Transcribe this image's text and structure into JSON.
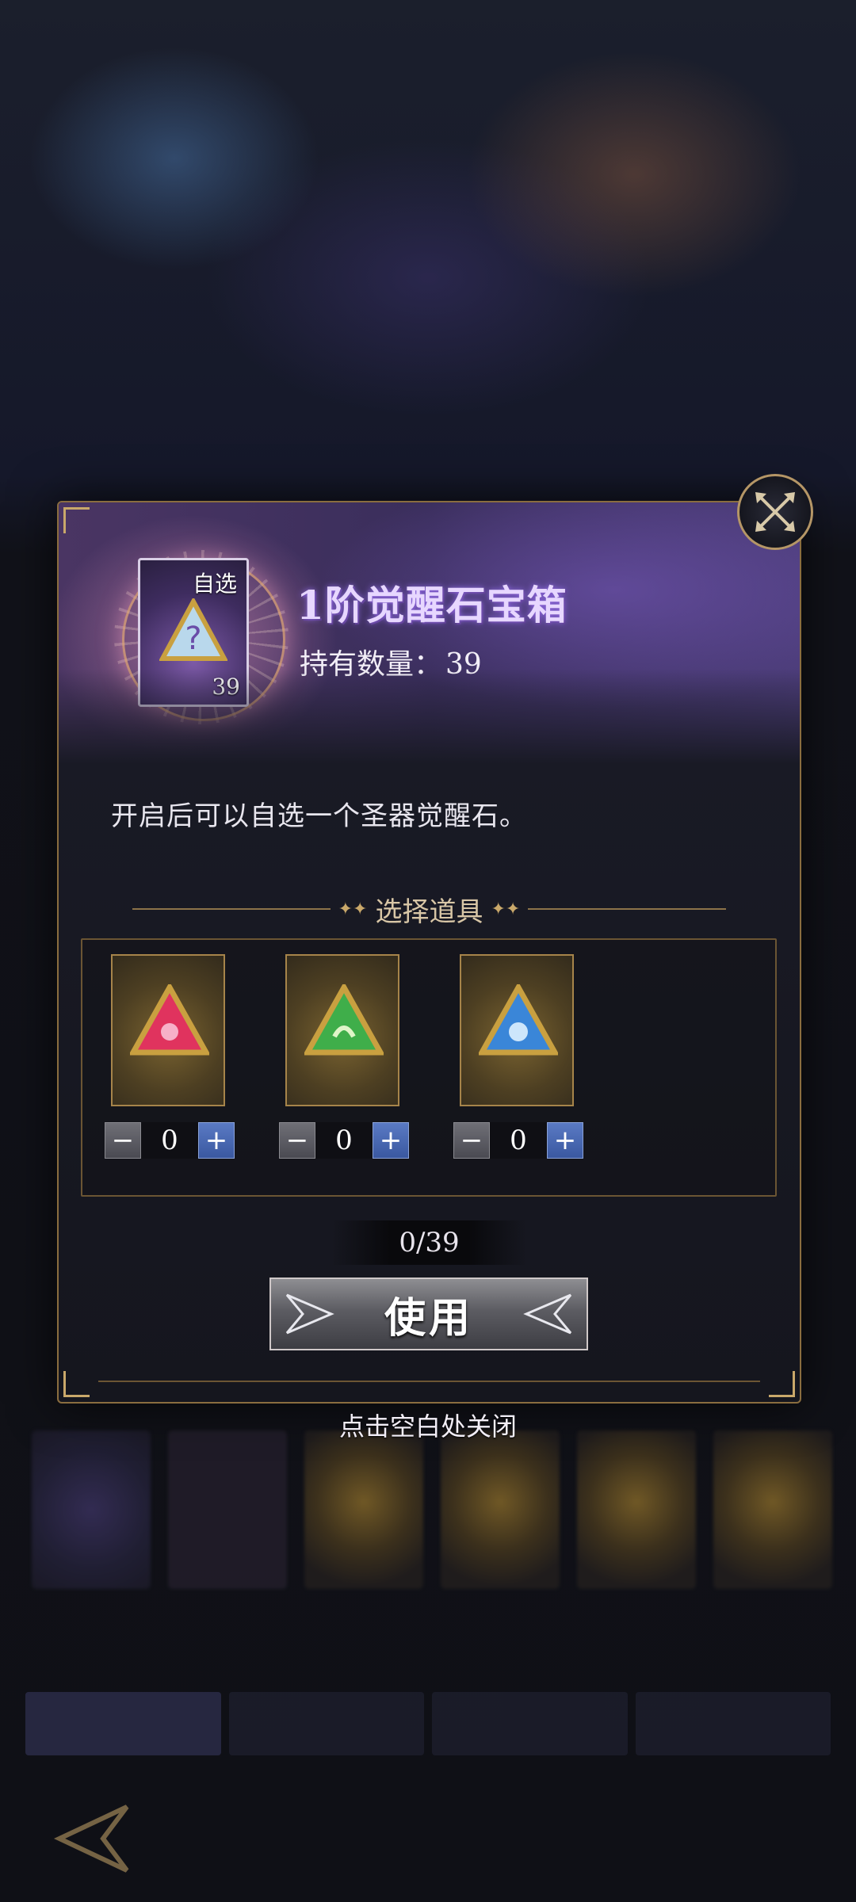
{
  "item": {
    "name": "1阶觉醒石宝箱",
    "owned_label": "持有数量：",
    "owned_count": "39",
    "card_tag": "自选",
    "card_qty": "39",
    "description": "开启后可以自选一个圣器觉醒石。"
  },
  "selection": {
    "title": "选择道具",
    "options": [
      {
        "name": "red-awakening-stone",
        "gem_color": "#e0335e",
        "value": "0",
        "minus": "−",
        "plus": "+"
      },
      {
        "name": "green-awakening-stone",
        "gem_color": "#3fae4a",
        "value": "0",
        "minus": "−",
        "plus": "+"
      },
      {
        "name": "blue-awakening-stone",
        "gem_color": "#3a86d8",
        "value": "0",
        "minus": "−",
        "plus": "+"
      }
    ],
    "counter": "0/39"
  },
  "actions": {
    "use_label": "使用",
    "close_hint": "点击空白处关闭"
  },
  "colors": {
    "gold_border": "#8a6d3f",
    "plus_blue": "#3a58a0",
    "title_glow": "#a078ff"
  }
}
